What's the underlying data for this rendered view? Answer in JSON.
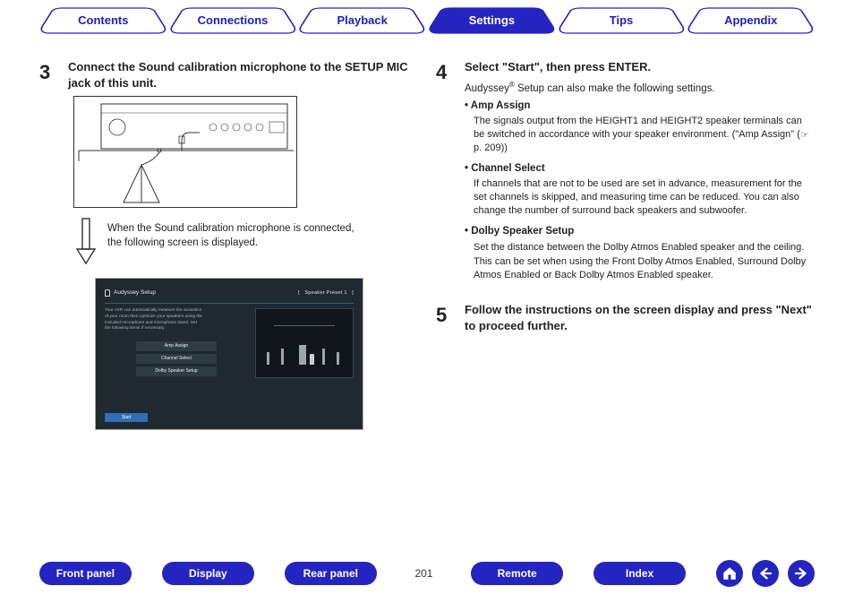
{
  "tabs": {
    "items": [
      {
        "label": "Contents",
        "active": false
      },
      {
        "label": "Connections",
        "active": false
      },
      {
        "label": "Playback",
        "active": false
      },
      {
        "label": "Settings",
        "active": true
      },
      {
        "label": "Tips",
        "active": false
      },
      {
        "label": "Appendix",
        "active": false
      }
    ]
  },
  "step3": {
    "num": "3",
    "title": "Connect the Sound calibration microphone to the SETUP MIC jack of this unit.",
    "note": "When the Sound calibration microphone is connected, the following screen is displayed."
  },
  "osd": {
    "title": "Audyssey Setup",
    "preset_left": "[",
    "preset": "Speaker Preset 1",
    "preset_right": "]",
    "desc": "Your AVR can automatically measure the acoustics of your room then optimize your speakers using the included microphone and microphone stand. Set the following items if necessary.",
    "btn1": "Amp Assign",
    "btn2": "Channel Select",
    "btn3": "Dolby Speaker Setup",
    "start": "Start"
  },
  "step4": {
    "num": "4",
    "title": "Select \"Start\", then press ENTER.",
    "intro_a": "Audyssey",
    "intro_reg": "®",
    "intro_b": " Setup can also make the following settings.",
    "items": [
      {
        "label": "Amp Assign",
        "desc_a": "The signals output from the HEIGHT1 and HEIGHT2 speaker terminals can be switched in accordance with your speaker environment. (\"Amp Assign\" (",
        "hand": "☞",
        "desc_b": " p. 209))"
      },
      {
        "label": "Channel Select",
        "desc": "If channels that are not to be used are set in advance, measurement for the set channels is skipped, and measuring time can be reduced. You can also change the number of surround back speakers and subwoofer."
      },
      {
        "label": "Dolby Speaker Setup",
        "desc": "Set the distance between the Dolby Atmos Enabled speaker and the ceiling.",
        "desc2": "This can be set when using the Front Dolby Atmos Enabled, Surround Dolby Atmos Enabled or Back Dolby Atmos Enabled speaker."
      }
    ]
  },
  "step5": {
    "num": "5",
    "title": "Follow the instructions on the screen display and press \"Next\" to proceed further."
  },
  "bottom": {
    "front_panel": "Front panel",
    "display": "Display",
    "rear_panel": "Rear panel",
    "page": "201",
    "remote": "Remote",
    "index": "Index"
  }
}
